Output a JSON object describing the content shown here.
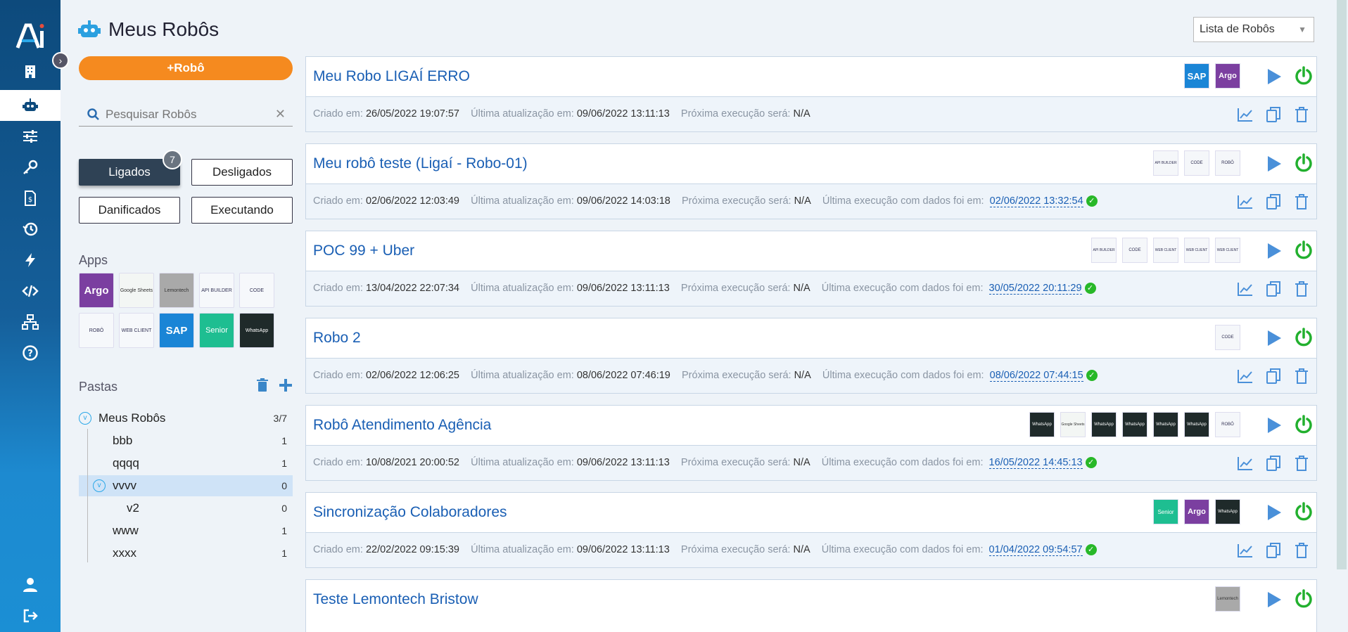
{
  "nav": {
    "logo": "AI",
    "items": [
      {
        "name": "building-icon"
      },
      {
        "name": "robot-icon",
        "active": true
      },
      {
        "name": "sliders-icon"
      },
      {
        "name": "key-icon"
      },
      {
        "name": "invoice-icon"
      },
      {
        "name": "history-icon"
      },
      {
        "name": "lightning-icon"
      },
      {
        "name": "code-icon"
      },
      {
        "name": "sitemap-icon"
      },
      {
        "name": "help-icon"
      }
    ],
    "bottom": [
      {
        "name": "user-icon"
      },
      {
        "name": "logout-icon"
      }
    ]
  },
  "panel": {
    "title": "Meus Robôs",
    "add_button": "+Robô",
    "search_placeholder": "Pesquisar Robôs",
    "filters": [
      {
        "label": "Ligados",
        "active": true,
        "badge": "7"
      },
      {
        "label": "Desligados"
      },
      {
        "label": "Danificados"
      },
      {
        "label": "Executando"
      }
    ],
    "apps_label": "Apps",
    "apps": [
      {
        "name": "Argo",
        "label": "Argo",
        "color": "#7b3fa0",
        "text_color": "#fff"
      },
      {
        "name": "Google Sheets",
        "label": "Google Sheets",
        "color": "#f3f6f4",
        "text_color": "#333"
      },
      {
        "name": "Lemontech",
        "label": "Lemontech",
        "color": "#a9a9a9",
        "text_color": "#333"
      },
      {
        "name": "API Builder",
        "label": "API BUILDER",
        "color": "#f6f8fb",
        "text_color": "#335"
      },
      {
        "name": "Code",
        "label": "CODE",
        "color": "#f6f8fb",
        "text_color": "#335"
      },
      {
        "name": "Robo",
        "label": "ROBÔ",
        "color": "#f6f8fb",
        "text_color": "#335"
      },
      {
        "name": "Web Client",
        "label": "WEB CLIENT",
        "color": "#f6f8fb",
        "text_color": "#335"
      },
      {
        "name": "SAP",
        "label": "SAP",
        "color": "#1a85d6",
        "text_color": "#fff"
      },
      {
        "name": "Senior",
        "label": "Senior",
        "color": "#1ebe91",
        "text_color": "#fff"
      },
      {
        "name": "WhatsApp",
        "label": "WhatsApp",
        "color": "#1f2a2a",
        "text_color": "#fff"
      }
    ],
    "folders_label": "Pastas",
    "folders": [
      {
        "name": "Meus Robôs",
        "count": "3/7",
        "level": 0,
        "expanded": true
      },
      {
        "name": "bbb",
        "count": "1",
        "level": 1
      },
      {
        "name": "qqqq",
        "count": "1",
        "level": 1
      },
      {
        "name": "vvvv",
        "count": "0",
        "level": 1,
        "expanded": true,
        "selected": true
      },
      {
        "name": "v2",
        "count": "0",
        "level": 2
      },
      {
        "name": "www",
        "count": "1",
        "level": 1
      },
      {
        "name": "xxxx",
        "count": "1",
        "level": 1
      }
    ]
  },
  "list": {
    "view_select": "Lista de Robôs",
    "labels": {
      "created": "Criado em:",
      "updated": "Última atualização em:",
      "next": "Próxima execução será:",
      "last": "Última execução com dados foi em:"
    },
    "robots": [
      {
        "name": "Meu Robo LIGAÍ ERRO",
        "apps": [
          "SAP",
          "Argo"
        ],
        "created": "26/05/2022 19:07:57",
        "updated": "09/06/2022 13:11:13",
        "next": "N/A",
        "last": ""
      },
      {
        "name": "Meu robô teste (Ligaí - Robo-01)",
        "apps": [
          "API Builder",
          "Code",
          "Robo"
        ],
        "created": "02/06/2022 12:03:49",
        "updated": "09/06/2022 14:03:18",
        "next": "N/A",
        "last": "02/06/2022 13:32:54"
      },
      {
        "name": "POC 99 + Uber",
        "apps": [
          "API Builder",
          "Code",
          "Web Client",
          "Web Client",
          "Web Client"
        ],
        "created": "13/04/2022 22:07:34",
        "updated": "09/06/2022 13:11:13",
        "next": "N/A",
        "last": "30/05/2022 20:11:29"
      },
      {
        "name": "Robo 2",
        "apps": [
          "Code"
        ],
        "created": "02/06/2022 12:06:25",
        "updated": "08/06/2022 07:46:19",
        "next": "N/A",
        "last": "08/06/2022 07:44:15"
      },
      {
        "name": "Robô Atendimento Agência",
        "apps": [
          "WhatsApp",
          "Google Sheets",
          "WhatsApp",
          "WhatsApp",
          "WhatsApp",
          "WhatsApp",
          "Robo"
        ],
        "created": "10/08/2021 20:00:52",
        "updated": "09/06/2022 13:11:13",
        "next": "N/A",
        "last": "16/05/2022 14:45:13"
      },
      {
        "name": "Sincronização Colaboradores",
        "apps": [
          "Senior",
          "Argo",
          "WhatsApp"
        ],
        "created": "22/02/2022 09:15:39",
        "updated": "09/06/2022 13:11:13",
        "next": "N/A",
        "last": "01/04/2022 09:54:57"
      },
      {
        "name": "Teste Lemontech Bristow",
        "apps": [
          "Lemontech"
        ],
        "created": "",
        "updated": "",
        "next": "",
        "last": ""
      }
    ]
  },
  "colors": {
    "accent_orange": "#f58a1f",
    "link_blue": "#1a5fb4",
    "play_blue": "#4a90d9",
    "power_green": "#22b02e",
    "nav_dark": "#0d4a7c"
  }
}
